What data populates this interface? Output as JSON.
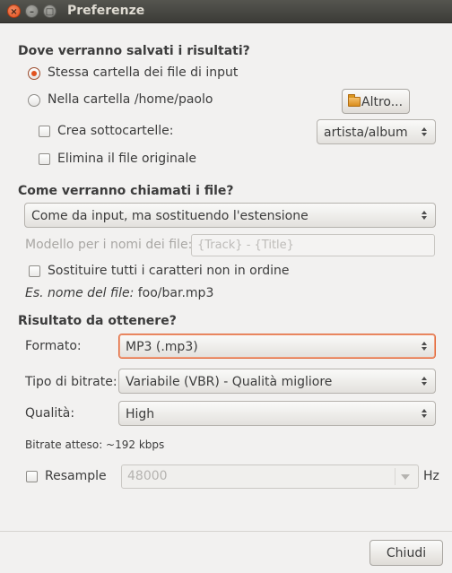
{
  "window": {
    "title": "Preferenze",
    "close_glyph": "×",
    "min_glyph": "–",
    "max_glyph": "□"
  },
  "save_section": {
    "heading": "Dove verranno salvati i risultati?",
    "radio_same_folder": "Stessa cartella dei file di input",
    "radio_folder": "Nella cartella /home/paolo",
    "other_button": "Altro...",
    "create_subfolders": "Crea sottocartelle:",
    "subfolder_combo": "artista/album",
    "delete_original": "Elimina il file originale"
  },
  "naming_section": {
    "heading": "Come verranno chiamati i file?",
    "naming_combo": "Come da input, ma sostituendo l'estensione",
    "pattern_label": "Modello per i nomi dei file:",
    "pattern_placeholder": "{Track} - {Title}",
    "replace_chars": "Sostituire tutti i caratteri non in ordine",
    "example_label": "Es. nome del file:",
    "example_value": "foo/bar.mp3"
  },
  "result_section": {
    "heading": "Risultato da ottenere?",
    "format_label": "Formato:",
    "format_value": "MP3 (.mp3)",
    "bitrate_label": "Tipo di bitrate:",
    "bitrate_value": "Variabile (VBR) - Qualità migliore",
    "quality_label": "Qualità:",
    "quality_value": "High",
    "expected_bitrate": "Bitrate atteso: ~192 kbps",
    "resample_label": "Resample",
    "resample_value": "48000",
    "resample_unit": "Hz"
  },
  "footer": {
    "close_button": "Chiudi"
  },
  "colors": {
    "accent": "#e1521e",
    "titlebar": "#3c3b37",
    "background": "#f2f1f0"
  }
}
